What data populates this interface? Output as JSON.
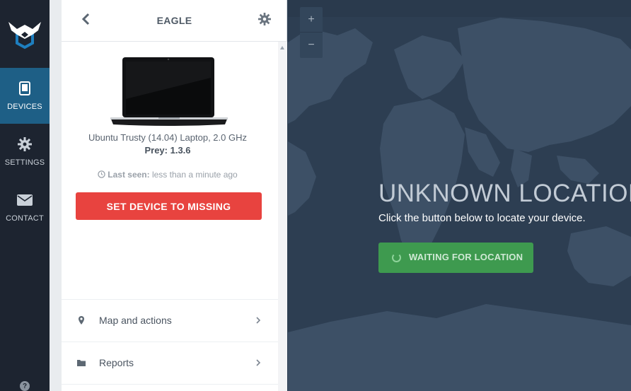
{
  "colors": {
    "rail_bg": "#1d2430",
    "rail_active": "#1e5f86",
    "accent_red": "#e8433f",
    "accent_green": "#3e9a4f",
    "map_bg": "#2d3e52"
  },
  "rail": {
    "logo_icon": "prey-eagle-logo",
    "items": [
      {
        "label": "DEVICES",
        "icon": "tablet-icon",
        "active": true
      },
      {
        "label": "SETTINGS",
        "icon": "gear-icon",
        "active": false
      },
      {
        "label": "CONTACT",
        "icon": "envelope-icon",
        "active": false
      }
    ],
    "help": "?"
  },
  "panel": {
    "title": "EAGLE",
    "back_icon": "chevron-left-icon",
    "settings_icon": "gear-icon",
    "device_image": "laptop-icon",
    "device_name": "Ubuntu Trusty (14.04) Laptop, 2.0 GHz",
    "prey_version": "Prey: 1.3.6",
    "last_seen_label": "Last seen:",
    "last_seen_value": "less than a minute ago",
    "missing_button": "SET DEVICE TO MISSING",
    "menu": [
      {
        "label": "Map and actions",
        "icon": "map-pin-icon"
      },
      {
        "label": "Reports",
        "icon": "folder-icon"
      }
    ]
  },
  "map": {
    "zoom_in": "+",
    "zoom_out": "−",
    "status_title": "UNKNOWN LOCATION",
    "status_subtitle": "Click the button below to locate your device.",
    "locate_button": "WAITING FOR LOCATION"
  }
}
